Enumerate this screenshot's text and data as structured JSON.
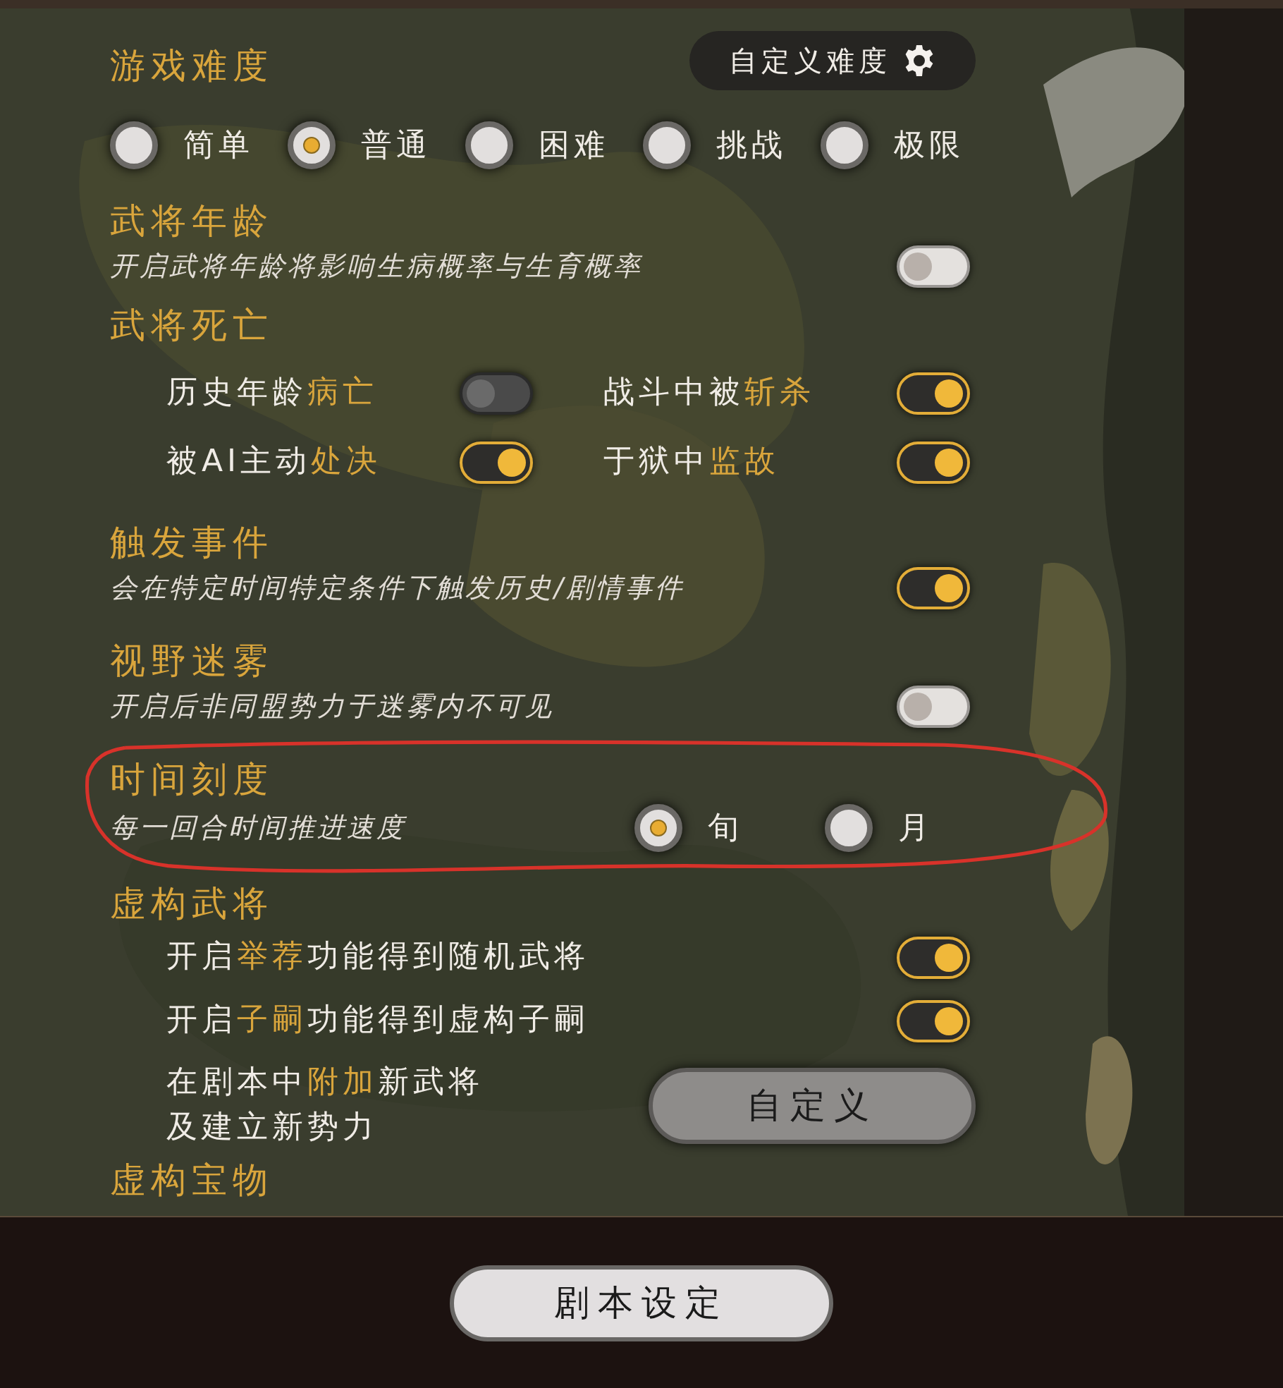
{
  "difficulty": {
    "title": "游戏难度",
    "custom_button": "自定义难度",
    "options": [
      {
        "label": "简单",
        "selected": false
      },
      {
        "label": "普通",
        "selected": true
      },
      {
        "label": "困难",
        "selected": false
      },
      {
        "label": "挑战",
        "selected": false
      },
      {
        "label": "极限",
        "selected": false
      }
    ]
  },
  "general_age": {
    "title": "武将年龄",
    "description": "开启武将年龄将影响生病概率与生育概率",
    "on": false
  },
  "general_death": {
    "title": "武将死亡",
    "options": [
      {
        "parts": [
          {
            "text": "历史年龄",
            "accent": false
          },
          {
            "text": "病亡",
            "accent": true
          }
        ],
        "on": false,
        "disabled": true
      },
      {
        "parts": [
          {
            "text": "战斗中被",
            "accent": false
          },
          {
            "text": "斩杀",
            "accent": true
          }
        ],
        "on": true,
        "disabled": false
      },
      {
        "parts": [
          {
            "text": "被AI主动",
            "accent": false
          },
          {
            "text": "处决",
            "accent": true
          }
        ],
        "on": true,
        "disabled": false
      },
      {
        "parts": [
          {
            "text": "于狱中",
            "accent": false
          },
          {
            "text": "监故",
            "accent": true
          }
        ],
        "on": true,
        "disabled": false
      }
    ]
  },
  "trigger_events": {
    "title": "触发事件",
    "description": "会在特定时间特定条件下触发历史/剧情事件",
    "on": true
  },
  "fog_of_war": {
    "title": "视野迷雾",
    "description": "开启后非同盟势力于迷雾内不可见",
    "on": false
  },
  "time_scale": {
    "title": "时间刻度",
    "description": "每一回合时间推进速度",
    "options": [
      {
        "label": "旬",
        "selected": true
      },
      {
        "label": "月",
        "selected": false
      }
    ]
  },
  "fictional_generals": {
    "title": "虚构武将",
    "items": [
      {
        "kind": "toggle",
        "parts": [
          {
            "text": "开启",
            "accent": false
          },
          {
            "text": "举荐",
            "accent": true
          },
          {
            "text": "功能得到随机武将",
            "accent": false
          }
        ],
        "on": true
      },
      {
        "kind": "toggle",
        "parts": [
          {
            "text": "开启",
            "accent": false
          },
          {
            "text": "子嗣",
            "accent": true
          },
          {
            "text": "功能得到虚构子嗣",
            "accent": false
          }
        ],
        "on": true
      },
      {
        "kind": "button",
        "parts": [
          {
            "text": "在剧本中",
            "accent": false
          },
          {
            "text": "附加",
            "accent": true
          },
          {
            "text": "新武将",
            "accent": false
          }
        ],
        "second_line": "及建立新势力",
        "button": "自定义"
      }
    ]
  },
  "fictional_treasures": {
    "title": "虚构宝物"
  },
  "footer_button": "剧本设定"
}
